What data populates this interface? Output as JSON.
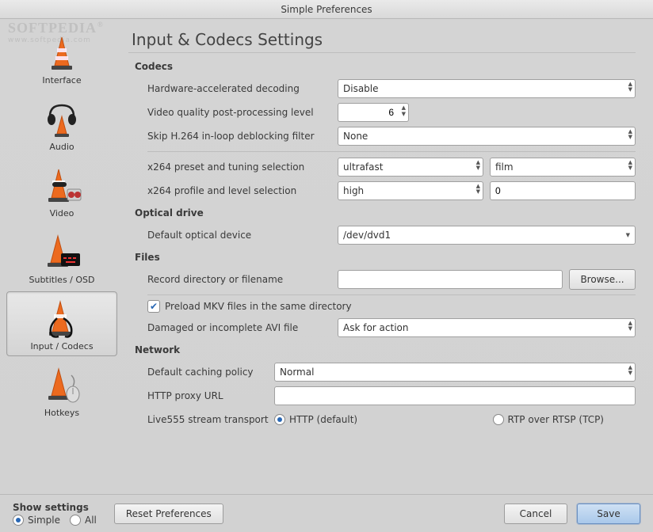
{
  "window": {
    "title": "Simple Preferences"
  },
  "sidebar": {
    "items": [
      {
        "label": "Interface"
      },
      {
        "label": "Audio"
      },
      {
        "label": "Video"
      },
      {
        "label": "Subtitles / OSD"
      },
      {
        "label": "Input / Codecs"
      },
      {
        "label": "Hotkeys"
      }
    ]
  },
  "page": {
    "title": "Input & Codecs Settings"
  },
  "codecs": {
    "heading": "Codecs",
    "hw_decode_label": "Hardware-accelerated decoding",
    "hw_decode_value": "Disable",
    "postproc_label": "Video quality post-processing level",
    "postproc_value": "6",
    "deblock_label": "Skip H.264 in-loop deblocking filter",
    "deblock_value": "None",
    "x264_preset_label": "x264 preset and tuning selection",
    "x264_preset_value": "ultrafast",
    "x264_tune_value": "film",
    "x264_profile_label": "x264 profile and level selection",
    "x264_profile_value": "high",
    "x264_level_value": "0"
  },
  "optical": {
    "heading": "Optical drive",
    "device_label": "Default optical device",
    "device_value": "/dev/dvd1"
  },
  "files": {
    "heading": "Files",
    "record_label": "Record directory or filename",
    "record_value": "",
    "browse_label": "Browse...",
    "preload_label": "Preload MKV files in the same directory",
    "avi_label": "Damaged or incomplete AVI file",
    "avi_value": "Ask for action"
  },
  "network": {
    "heading": "Network",
    "caching_label": "Default caching policy",
    "caching_value": "Normal",
    "proxy_label": "HTTP proxy URL",
    "proxy_value": "",
    "transport_label": "Live555 stream transport",
    "transport_http": "HTTP (default)",
    "transport_rtp": "RTP over RTSP (TCP)"
  },
  "footer": {
    "show_settings": "Show settings",
    "simple": "Simple",
    "all": "All",
    "reset": "Reset Preferences",
    "cancel": "Cancel",
    "save": "Save"
  }
}
